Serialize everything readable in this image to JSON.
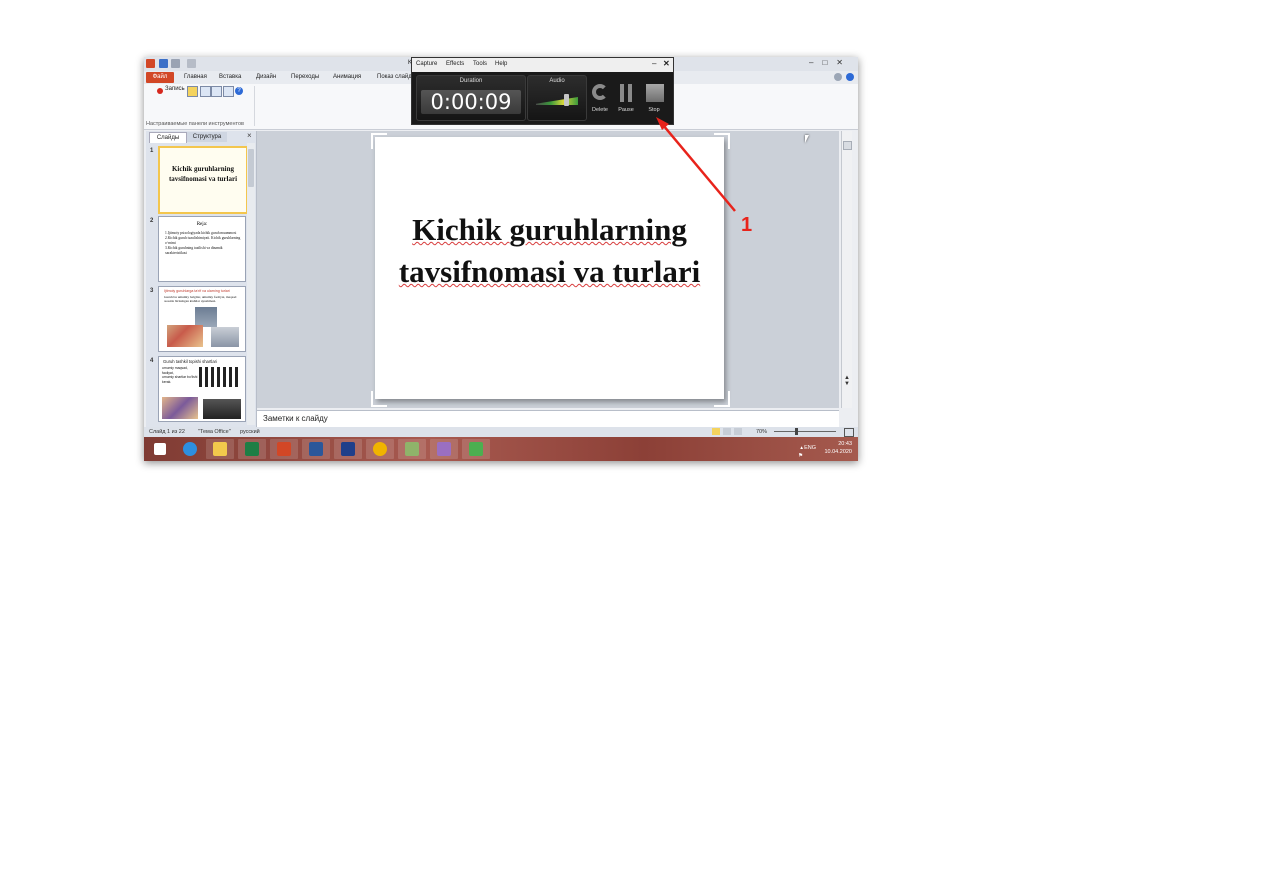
{
  "app_window": {
    "title_fragment": "K",
    "ribbon_tabs": [
      "Файл",
      "Главная",
      "Вставка",
      "Дизайн",
      "Переходы",
      "Анимация",
      "Показ слайд"
    ],
    "record_button": "Запись",
    "group_label": "Настраиваемые панели инструментов",
    "pane_tabs": {
      "slides": "Слайды",
      "outline": "Структура"
    },
    "thumbnails": [
      {
        "num": "1",
        "title": "Kichik guruhlarning tavsifnomasi va turlari"
      },
      {
        "num": "2",
        "title": "Reja:",
        "lines": [
          "1.Ijtimoiy psixologiyada kichik guruh muammosi",
          "2.Kichik guruh tuzulishimiyati. Kichik guruhlarning o‘rnimi",
          "3.Kichik guruhning tuzilishi va dinamik xarakteristikasi"
        ]
      },
      {
        "num": "3",
        "title": "Ijtimoiy guruhlarga ta‘rif va ularning turlari",
        "lines": [
          "Guruh bu umumiy belgilar, umumiy faoliyat, maqsad asosida birlashgan kishilar uyushmasi."
        ]
      },
      {
        "num": "4",
        "title": "Guruh tashkil topishi shartlari",
        "lines": [
          "umumiy maqsad,",
          "faoliyat,",
          "umumiy shartlar bo‘lishi kerak."
        ]
      }
    ],
    "slide_title": "Kichik guruhlarning tavsifnomasi va turlari",
    "notes_placeholder": "Заметки к слайду",
    "status": {
      "slide": "Слайд 1 из 22",
      "theme": "\"Тема Office\"",
      "lang": "русский",
      "zoom": "70%"
    },
    "tray": {
      "lang": "ENG",
      "time": "20:43",
      "date": "10.04.2020"
    }
  },
  "recorder": {
    "menu": [
      "Capture",
      "Effects",
      "Tools",
      "Help"
    ],
    "duration_label": "Duration",
    "duration_value": "0:00:09",
    "audio_label": "Audio",
    "buttons": {
      "delete": "Delete",
      "pause": "Pause",
      "stop": "Stop"
    }
  },
  "annotation": {
    "label": "1",
    "color": "#e8231b"
  },
  "colors": {
    "file_tab": "#d24726",
    "taskbar": "#8c4037",
    "recorder_bg": "#1a1a1a"
  }
}
